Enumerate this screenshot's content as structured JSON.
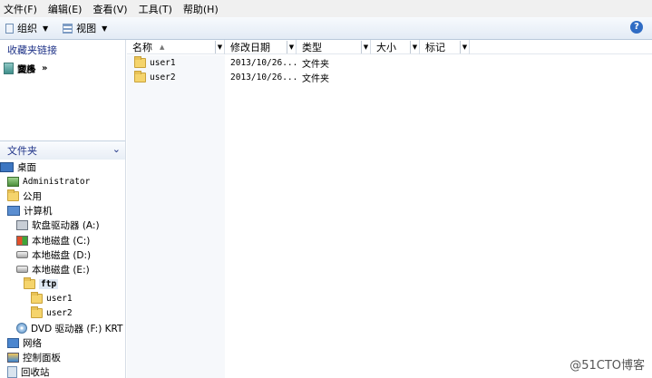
{
  "menu": [
    "文件(F)",
    "编辑(E)",
    "查看(V)",
    "工具(T)",
    "帮助(H)"
  ],
  "toolbar": {
    "organize": "组织",
    "views": "视图",
    "help_icon": "?"
  },
  "favorites": {
    "header": "收藏夹链接",
    "items": [
      "文档",
      "图片",
      "音乐"
    ],
    "more": "更多",
    "more_arrow": "»"
  },
  "folders": {
    "header": "文件夹"
  },
  "tree": [
    {
      "label": "桌面",
      "icon": "desktop-icon",
      "indent": 0
    },
    {
      "label": "Administrator",
      "icon": "user-folder-icon",
      "indent": 1,
      "mono": true
    },
    {
      "label": "公用",
      "icon": "folder-icon",
      "indent": 1
    },
    {
      "label": "计算机",
      "icon": "computer-icon",
      "indent": 1
    },
    {
      "label": "软盘驱动器 (A:)",
      "icon": "floppy-drive-icon",
      "indent": 2
    },
    {
      "label": "本地磁盘 (C:)",
      "icon": "system-drive-icon",
      "indent": 2
    },
    {
      "label": "本地磁盘 (D:)",
      "icon": "drive-icon",
      "indent": 2
    },
    {
      "label": "本地磁盘 (E:)",
      "icon": "drive-icon",
      "indent": 2
    },
    {
      "label": "ftp",
      "icon": "folder-icon",
      "indent": 3,
      "selected": true,
      "mono": true
    },
    {
      "label": "user1",
      "icon": "folder-icon",
      "indent": 4,
      "mono": true
    },
    {
      "label": "user2",
      "icon": "folder-icon",
      "indent": 4,
      "mono": true
    },
    {
      "label": "DVD 驱动器 (F:) KRT",
      "icon": "dvd-drive-icon",
      "indent": 2
    },
    {
      "label": "网络",
      "icon": "network-icon",
      "indent": 1
    },
    {
      "label": "控制面板",
      "icon": "control-panel-icon",
      "indent": 1
    },
    {
      "label": "回收站",
      "icon": "recycle-bin-icon",
      "indent": 1
    }
  ],
  "columns": [
    "名称",
    "修改日期",
    "类型",
    "大小",
    "标记"
  ],
  "files": [
    {
      "name": "user1",
      "modified": "2013/10/26...",
      "type": "文件夹"
    },
    {
      "name": "user2",
      "modified": "2013/10/26...",
      "type": "文件夹"
    }
  ],
  "watermark": "@51CTO博客"
}
